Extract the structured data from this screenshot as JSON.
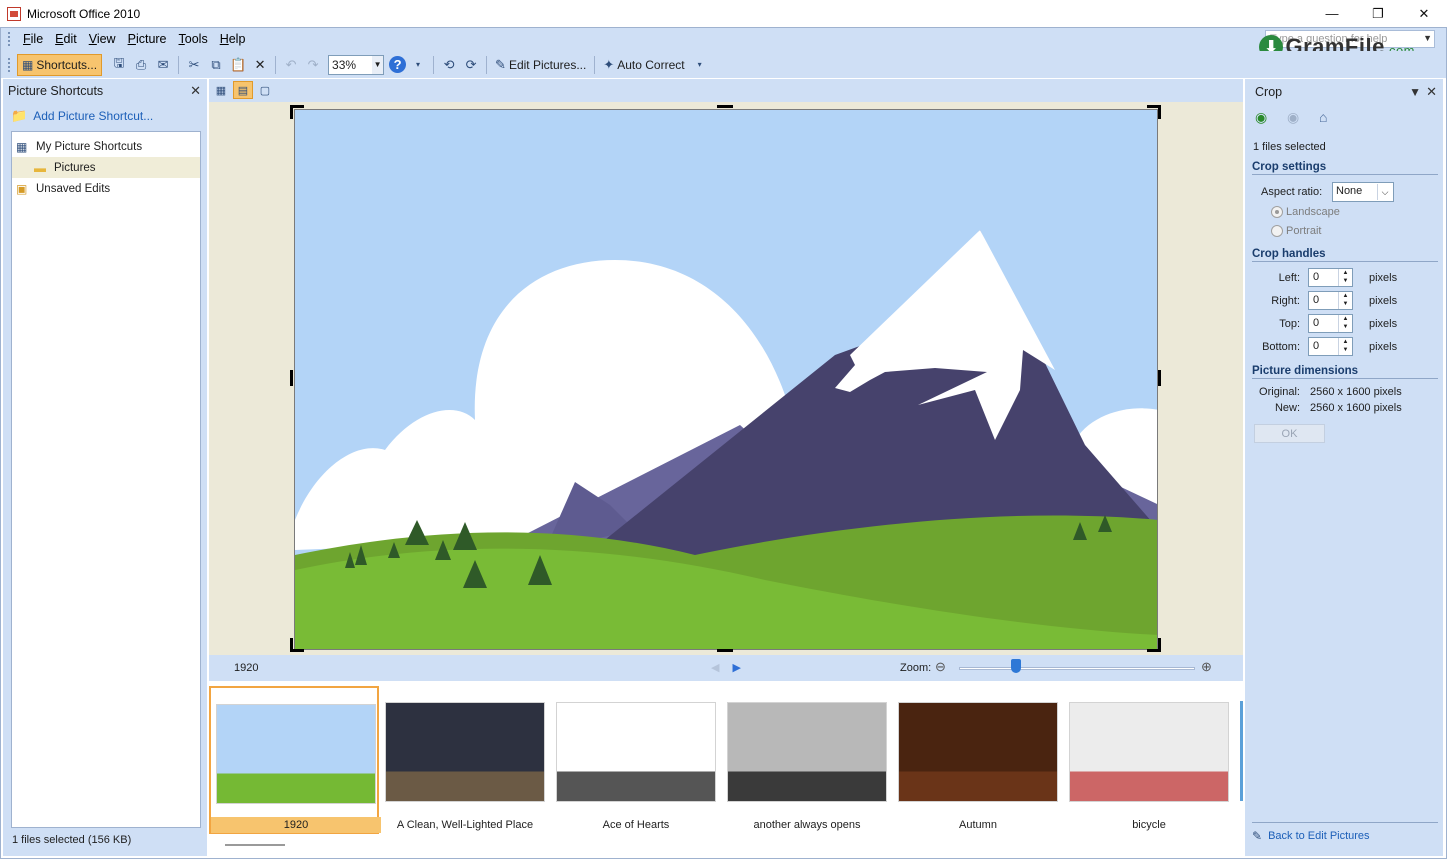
{
  "window": {
    "title": "Microsoft Office 2010",
    "minimize": "—",
    "restore": "❐",
    "close": "✕"
  },
  "menu": {
    "items": [
      {
        "key": "F",
        "rest": "ile"
      },
      {
        "key": "E",
        "rest": "dit"
      },
      {
        "key": "V",
        "rest": "iew"
      },
      {
        "key": "P",
        "rest": "icture"
      },
      {
        "key": "T",
        "rest": "ools"
      },
      {
        "key": "H",
        "rest": "elp"
      }
    ],
    "help_placeholder": "Type a question for help"
  },
  "watermark": {
    "main": "GramFile",
    "suffix": ".com"
  },
  "toolbar": {
    "shortcuts_label": "Shortcuts...",
    "zoom_value": "33%",
    "edit_pictures_label": "Edit Pictures...",
    "auto_correct_label": "Auto Correct",
    "icons": [
      "save-icon",
      "print-icon",
      "email-icon",
      "cut-icon",
      "copy-icon",
      "paste-icon",
      "delete-icon",
      "undo-icon",
      "redo-icon",
      "help-icon",
      "rotate-left-icon",
      "rotate-right-icon"
    ]
  },
  "left_pane": {
    "title": "Picture Shortcuts",
    "add_shortcut": "Add Picture Shortcut...",
    "tree": [
      {
        "label": "My Picture Shortcuts",
        "level": 0
      },
      {
        "label": "Pictures",
        "level": 1
      },
      {
        "label": "Unsaved Edits",
        "level": 0
      }
    ],
    "status": "1 files selected (156 KB)"
  },
  "center": {
    "picture_name": "1920",
    "zoom_label": "Zoom:",
    "zoom_level": 0.24
  },
  "filmstrip": [
    {
      "label": "1920",
      "selected": true,
      "colors": {
        "bg": "#b3d4f7",
        "ground": "#75b934"
      }
    },
    {
      "label": "A Clean, Well-Lighted Place",
      "selected": false,
      "colors": {
        "bg": "#2d3140",
        "ground": "#6b5a45"
      }
    },
    {
      "label": "Ace of Hearts",
      "selected": false,
      "colors": {
        "bg": "#ffffff",
        "ground": "#555555"
      }
    },
    {
      "label": "another always opens",
      "selected": false,
      "colors": {
        "bg": "#b8b8b8",
        "ground": "#3a3a3a"
      }
    },
    {
      "label": "Autumn",
      "selected": false,
      "colors": {
        "bg": "#4a2410",
        "ground": "#6a3418"
      }
    },
    {
      "label": "bicycle",
      "selected": false,
      "colors": {
        "bg": "#ececec",
        "ground": "#cc6666"
      }
    }
  ],
  "right_pane": {
    "title": "Crop",
    "files_selected": "1 files selected",
    "crop_settings": "Crop settings",
    "aspect_ratio_label": "Aspect ratio:",
    "aspect_ratio_value": "None",
    "landscape": "Landscape",
    "portrait": "Portrait",
    "crop_handles": "Crop handles",
    "handles": [
      {
        "label": "Left:",
        "value": "0",
        "unit": "pixels"
      },
      {
        "label": "Right:",
        "value": "0",
        "unit": "pixels"
      },
      {
        "label": "Top:",
        "value": "0",
        "unit": "pixels"
      },
      {
        "label": "Bottom:",
        "value": "0",
        "unit": "pixels"
      }
    ],
    "picture_dimensions": "Picture dimensions",
    "original_label": "Original:",
    "original_value": "2560 x 1600 pixels",
    "new_label": "New:",
    "new_value": "2560 x 1600 pixels",
    "ok_label": "OK",
    "back_link": "Back to Edit Pictures"
  }
}
